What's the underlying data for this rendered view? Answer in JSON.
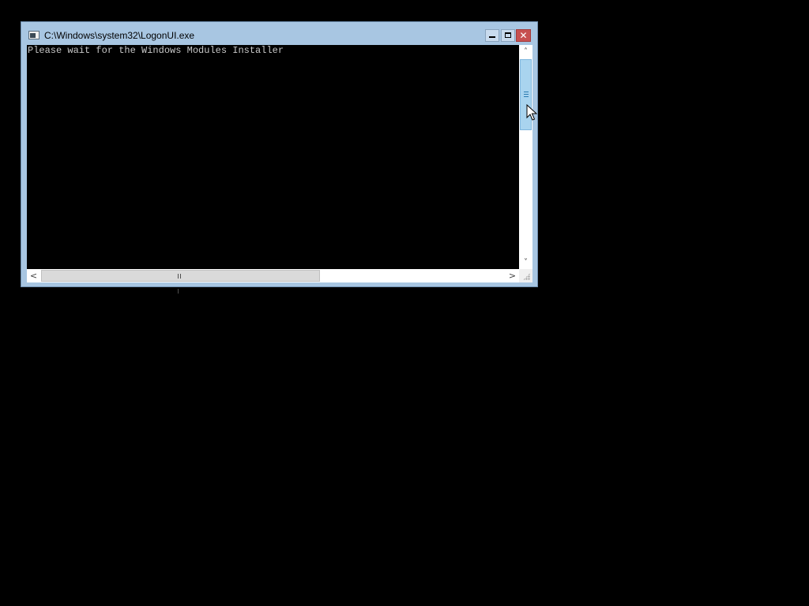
{
  "window": {
    "title": "C:\\Windows\\system32\\LogonUI.exe",
    "buttons": {
      "minimize": "minimize-icon",
      "maximize": "maximize-icon",
      "close": "close-icon",
      "close_glyph": "✕"
    },
    "colors": {
      "frame": "#a8c6e2",
      "close_button": "#c75050",
      "console_bg": "#000000",
      "console_text": "#c8c8c8",
      "scroll_thumb": "#a9d4ef"
    }
  },
  "console": {
    "lines": [
      "Please wait for the Windows Modules Installer"
    ]
  },
  "scrollbars": {
    "vertical": {
      "up_arrow": "˄",
      "down_arrow": "˅"
    },
    "horizontal": {
      "left_arrow": "<",
      "right_arrow": ">"
    }
  },
  "desktop": {
    "background": "#000000"
  }
}
